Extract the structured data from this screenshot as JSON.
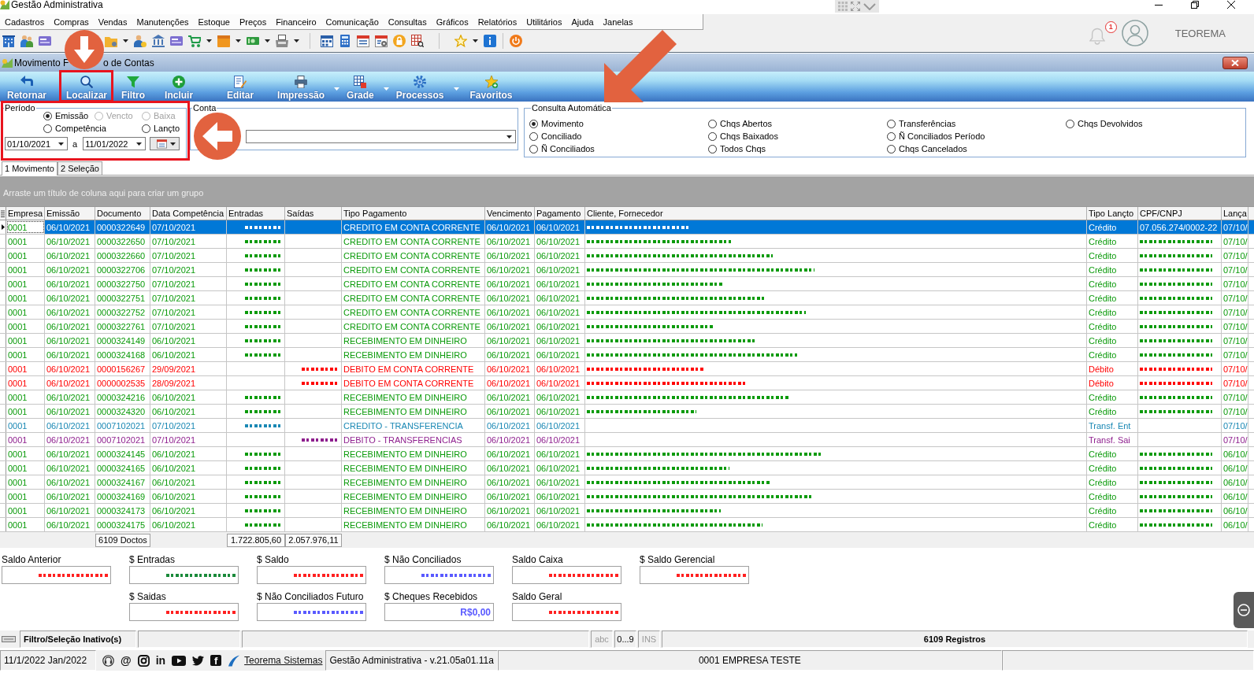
{
  "app_window": {
    "title": "Gestão Administrativa"
  },
  "menu": [
    "Cadastros",
    "Compras",
    "Vendas",
    "Manutenções",
    "Estoque",
    "Preços",
    "Financeiro",
    "Comunicação",
    "Consultas",
    "Gráficos",
    "Relatórios",
    "Utilitários",
    "Ajuda",
    "Janelas"
  ],
  "header_right": {
    "notification_count": "1",
    "user": "TEOREMA"
  },
  "child_window": {
    "title_parts": [
      "Movimento F",
      "o de Contas"
    ]
  },
  "toolbar": [
    {
      "label": "Retornar",
      "dropdown": false
    },
    {
      "label": "Localizar",
      "dropdown": false
    },
    {
      "label": "Filtro",
      "dropdown": false
    },
    {
      "label": "Incluir",
      "dropdown": false
    },
    {
      "label": "Editar",
      "dropdown": false
    },
    {
      "label": "Impressão",
      "dropdown": true
    },
    {
      "label": "Grade",
      "dropdown": true
    },
    {
      "label": "Processos",
      "dropdown": true
    },
    {
      "label": "Favoritos",
      "dropdown": false
    }
  ],
  "periodo": {
    "title": "Período",
    "rows": [
      [
        {
          "label": "Emissão",
          "selected": true,
          "disabled": false
        },
        {
          "label": "Vencto",
          "selected": false,
          "disabled": true
        },
        {
          "label": "Baixa",
          "selected": false,
          "disabled": true
        }
      ],
      [
        {
          "label": "Competência",
          "selected": false,
          "disabled": false
        },
        "",
        {
          "label": "Lançto",
          "selected": false,
          "disabled": false
        }
      ]
    ],
    "date_from": "01/10/2021",
    "separator": "a",
    "date_to": "11/01/2022"
  },
  "conta": {
    "title": "Conta"
  },
  "consulta": {
    "title": "Consulta Automática",
    "columns": [
      [
        {
          "label": "Movimento",
          "selected": true
        },
        {
          "label": "Conciliado",
          "selected": false
        },
        {
          "label": "Ñ Conciliados",
          "selected": false
        }
      ],
      [
        {
          "label": "Chqs Abertos",
          "selected": false
        },
        {
          "label": "Chqs Baixados",
          "selected": false
        },
        {
          "label": "Todos Chqs",
          "selected": false
        }
      ],
      [
        {
          "label": "Transferências",
          "selected": false
        },
        {
          "label": "Ñ Conciliados Período",
          "selected": false
        },
        {
          "label": "Chqs Cancelados",
          "selected": false
        }
      ],
      [
        {
          "label": "Chqs Devolvidos",
          "selected": false
        }
      ]
    ]
  },
  "tabs": [
    {
      "label": "1 Movimento",
      "selected": true
    },
    {
      "label": "2 Seleção",
      "selected": false
    }
  ],
  "group_panel": {
    "hint": "Arraste um título de coluna aqui para criar um grupo"
  },
  "grid": {
    "columns": [
      {
        "label": "Empresa",
        "kind": "text"
      },
      {
        "label": "Emissão",
        "kind": "text"
      },
      {
        "label": "Documento",
        "kind": "text",
        "total": "6109 Doctos"
      },
      {
        "label": "Data Competência",
        "kind": "text"
      },
      {
        "label": "Entradas",
        "kind": "money",
        "total": "1.722.805,60"
      },
      {
        "label": "Saídas",
        "kind": "money",
        "total": "2.057.976,11"
      },
      {
        "label": "Tipo Pagamento",
        "kind": "text"
      },
      {
        "label": "Vencimento",
        "kind": "text"
      },
      {
        "label": "Pagamento",
        "kind": "text"
      },
      {
        "label": "Cliente, Fornecedor",
        "kind": "name"
      },
      {
        "label": "Tipo Lançto",
        "kind": "text"
      },
      {
        "label": "CPF/CNPJ",
        "kind": "text"
      },
      {
        "label": "Lança",
        "kind": "text"
      }
    ],
    "rows": [
      {
        "selected": true,
        "color": "#0a9a0a",
        "cells": [
          "0001",
          "06/10/2021",
          "0000322649",
          "07/10/2021",
          {
            "redacted": true
          },
          "",
          "CREDITO EM CONTA CORRENTE",
          "06/10/2021",
          "06/10/2021",
          {
            "redacted": true
          },
          "Crédito",
          "07.056.274/0002-22",
          "07/10/"
        ]
      },
      {
        "selected": false,
        "color": "#0a9a0a",
        "cells": [
          "0001",
          "06/10/2021",
          "0000322650",
          "07/10/2021",
          {
            "redacted": true
          },
          "",
          "CREDITO EM CONTA CORRENTE",
          "06/10/2021",
          "06/10/2021",
          {
            "redacted": true
          },
          "Crédito",
          {
            "redacted": true
          },
          "07/10/"
        ]
      },
      {
        "selected": false,
        "color": "#0a9a0a",
        "cells": [
          "0001",
          "06/10/2021",
          "0000322660",
          "07/10/2021",
          {
            "redacted": true
          },
          "",
          "CREDITO EM CONTA CORRENTE",
          "06/10/2021",
          "06/10/2021",
          {
            "redacted": true
          },
          "Crédito",
          {
            "redacted": true
          },
          "07/10/"
        ]
      },
      {
        "selected": false,
        "color": "#0a9a0a",
        "cells": [
          "0001",
          "06/10/2021",
          "0000322706",
          "07/10/2021",
          {
            "redacted": true
          },
          "",
          "CREDITO EM CONTA CORRENTE",
          "06/10/2021",
          "06/10/2021",
          {
            "redacted": true
          },
          "Crédito",
          {
            "redacted": true
          },
          "07/10/"
        ]
      },
      {
        "selected": false,
        "color": "#0a9a0a",
        "cells": [
          "0001",
          "06/10/2021",
          "0000322750",
          "07/10/2021",
          {
            "redacted": true
          },
          "",
          "CREDITO EM CONTA CORRENTE",
          "06/10/2021",
          "06/10/2021",
          {
            "redacted": true
          },
          "Crédito",
          {
            "redacted": true
          },
          "07/10/"
        ]
      },
      {
        "selected": false,
        "color": "#0a9a0a",
        "cells": [
          "0001",
          "06/10/2021",
          "0000322751",
          "07/10/2021",
          {
            "redacted": true
          },
          "",
          "CREDITO EM CONTA CORRENTE",
          "06/10/2021",
          "06/10/2021",
          {
            "redacted": true
          },
          "Crédito",
          {
            "redacted": true
          },
          "07/10/"
        ]
      },
      {
        "selected": false,
        "color": "#0a9a0a",
        "cells": [
          "0001",
          "06/10/2021",
          "0000322752",
          "07/10/2021",
          {
            "redacted": true
          },
          "",
          "CREDITO EM CONTA CORRENTE",
          "06/10/2021",
          "06/10/2021",
          {
            "redacted": true
          },
          "Crédito",
          {
            "redacted": true
          },
          "07/10/"
        ]
      },
      {
        "selected": false,
        "color": "#0a9a0a",
        "cells": [
          "0001",
          "06/10/2021",
          "0000322761",
          "07/10/2021",
          {
            "redacted": true
          },
          "",
          "CREDITO EM CONTA CORRENTE",
          "06/10/2021",
          "06/10/2021",
          {
            "redacted": true
          },
          "Crédito",
          {
            "redacted": true
          },
          "07/10/"
        ]
      },
      {
        "selected": false,
        "color": "#0a9a0a",
        "cells": [
          "0001",
          "06/10/2021",
          "0000324149",
          "06/10/2021",
          {
            "redacted": true
          },
          "",
          "RECEBIMENTO EM DINHEIRO",
          "06/10/2021",
          "06/10/2021",
          {
            "redacted": true
          },
          "Crédito",
          {
            "redacted": true
          },
          "07/10/"
        ]
      },
      {
        "selected": false,
        "color": "#0a9a0a",
        "cells": [
          "0001",
          "06/10/2021",
          "0000324168",
          "06/10/2021",
          {
            "redacted": true
          },
          "",
          "RECEBIMENTO EM DINHEIRO",
          "06/10/2021",
          "06/10/2021",
          {
            "redacted": true
          },
          "Crédito",
          {
            "redacted": true
          },
          "07/10/"
        ]
      },
      {
        "selected": false,
        "color": "#ff0000",
        "cells": [
          "0001",
          "06/10/2021",
          "0000156267",
          "29/09/2021",
          "",
          {
            "redacted": true
          },
          "DEBITO EM CONTA CORRENTE",
          "06/10/2021",
          "06/10/2021",
          {
            "redacted": true
          },
          "Débito",
          {
            "redacted": true
          },
          "07/10/"
        ]
      },
      {
        "selected": false,
        "color": "#ff0000",
        "cells": [
          "0001",
          "06/10/2021",
          "0000002535",
          "28/09/2021",
          "",
          {
            "redacted": true
          },
          "DEBITO EM CONTA CORRENTE",
          "06/10/2021",
          "06/10/2021",
          {
            "redacted": true
          },
          "Débito",
          {
            "redacted": true
          },
          "07/10/"
        ]
      },
      {
        "selected": false,
        "color": "#0a9a0a",
        "cells": [
          "0001",
          "06/10/2021",
          "0000324216",
          "06/10/2021",
          {
            "redacted": true
          },
          "",
          "RECEBIMENTO EM DINHEIRO",
          "06/10/2021",
          "06/10/2021",
          {
            "redacted": true
          },
          "Crédito",
          {
            "redacted": true
          },
          "07/10/"
        ]
      },
      {
        "selected": false,
        "color": "#0a9a0a",
        "cells": [
          "0001",
          "06/10/2021",
          "0000324320",
          "06/10/2021",
          {
            "redacted": true
          },
          "",
          "RECEBIMENTO EM DINHEIRO",
          "06/10/2021",
          "06/10/2021",
          {
            "redacted": true
          },
          "Crédito",
          {
            "redacted": true
          },
          "07/10/"
        ]
      },
      {
        "selected": false,
        "color": "#1a88b4",
        "cells": [
          "0001",
          "06/10/2021",
          "0007102021",
          "07/10/2021",
          {
            "redacted": true
          },
          "",
          "CREDITO - TRANSFERENCIA",
          "06/10/2021",
          "06/10/2021",
          "",
          "Transf. Ent",
          "",
          "07/10/"
        ]
      },
      {
        "selected": false,
        "color": "#8e1f8e",
        "cells": [
          "0001",
          "06/10/2021",
          "0007102021",
          "07/10/2021",
          "",
          {
            "redacted": true
          },
          "DEBITO - TRANSFERENCIAS",
          "06/10/2021",
          "06/10/2021",
          "",
          "Transf. Sai",
          "",
          "07/10/"
        ]
      },
      {
        "selected": false,
        "color": "#0a9a0a",
        "cells": [
          "0001",
          "06/10/2021",
          "0000324145",
          "06/10/2021",
          {
            "redacted": true
          },
          "",
          "RECEBIMENTO EM DINHEIRO",
          "06/10/2021",
          "06/10/2021",
          {
            "redacted": true
          },
          "Crédito",
          {
            "redacted": true
          },
          "06/10/"
        ]
      },
      {
        "selected": false,
        "color": "#0a9a0a",
        "cells": [
          "0001",
          "06/10/2021",
          "0000324165",
          "06/10/2021",
          {
            "redacted": true
          },
          "",
          "RECEBIMENTO EM DINHEIRO",
          "06/10/2021",
          "06/10/2021",
          {
            "redacted": true
          },
          "Crédito",
          {
            "redacted": true
          },
          "06/10/"
        ]
      },
      {
        "selected": false,
        "color": "#0a9a0a",
        "cells": [
          "0001",
          "06/10/2021",
          "0000324167",
          "06/10/2021",
          {
            "redacted": true
          },
          "",
          "RECEBIMENTO EM DINHEIRO",
          "06/10/2021",
          "06/10/2021",
          {
            "redacted": true
          },
          "Crédito",
          {
            "redacted": true
          },
          "06/10/"
        ]
      },
      {
        "selected": false,
        "color": "#0a9a0a",
        "cells": [
          "0001",
          "06/10/2021",
          "0000324169",
          "06/10/2021",
          {
            "redacted": true
          },
          "",
          "RECEBIMENTO EM DINHEIRO",
          "06/10/2021",
          "06/10/2021",
          {
            "redacted": true
          },
          "Crédito",
          {
            "redacted": true
          },
          "06/10/"
        ]
      },
      {
        "selected": false,
        "color": "#0a9a0a",
        "cells": [
          "0001",
          "06/10/2021",
          "0000324173",
          "06/10/2021",
          {
            "redacted": true
          },
          "",
          "RECEBIMENTO EM DINHEIRO",
          "06/10/2021",
          "06/10/2021",
          {
            "redacted": true
          },
          "Crédito",
          {
            "redacted": true
          },
          "06/10/"
        ]
      },
      {
        "selected": false,
        "color": "#0a9a0a",
        "cells": [
          "0001",
          "06/10/2021",
          "0000324175",
          "06/10/2021",
          {
            "redacted": true
          },
          "",
          "RECEBIMENTO EM DINHEIRO",
          "06/10/2021",
          "06/10/2021",
          {
            "redacted": true
          },
          "Crédito",
          {
            "redacted": true
          },
          "06/10/"
        ]
      }
    ]
  },
  "totals": [
    [
      {
        "label": "Saldo Anterior",
        "redacted": true,
        "color": "#ff2020"
      },
      {
        "label": "$ Entradas",
        "redacted": true,
        "color": "#1a8a3a"
      },
      {
        "label": "$ Saldo",
        "redacted": true,
        "color": "#ff2020"
      },
      {
        "label": "$ Não Conciliados",
        "redacted": true,
        "color": "#5a5aff"
      },
      {
        "label": "Saldo Caixa",
        "redacted": true,
        "color": "#ff2020"
      },
      {
        "label": "$ Saldo Gerencial",
        "redacted": true,
        "color": "#ff2020"
      }
    ],
    [
      {
        "label": "$ Saidas",
        "redacted": true,
        "color": "#ff2020"
      },
      {
        "label": "$ Não Conciliados Futuro",
        "redacted": true,
        "color": "#5a5aff"
      },
      {
        "label": "$ Cheques Recebidos",
        "redacted": false,
        "value": "R$0,00",
        "color": "#5a5aff"
      },
      {
        "label": "Saldo Geral",
        "redacted": true,
        "color": "#ff2020"
      }
    ]
  ],
  "status_bar": {
    "filter": "Filtro/Seleção Inativo(s)",
    "indicators": [
      {
        "label": "abc",
        "active": false
      },
      {
        "label": "0...9",
        "active": true
      },
      {
        "label": "INS",
        "active": false
      }
    ],
    "records": "6109 Registros"
  },
  "footer_bar": {
    "date": "11/1/2022 Jan/2022",
    "social_glyphs": [
      "@",
      "in",
      "f"
    ],
    "link": "Teorema Sistemas",
    "version": "Gestão Administrativa - v.21.05a01.11a",
    "company": "0001 EMPRESA TESTE"
  }
}
